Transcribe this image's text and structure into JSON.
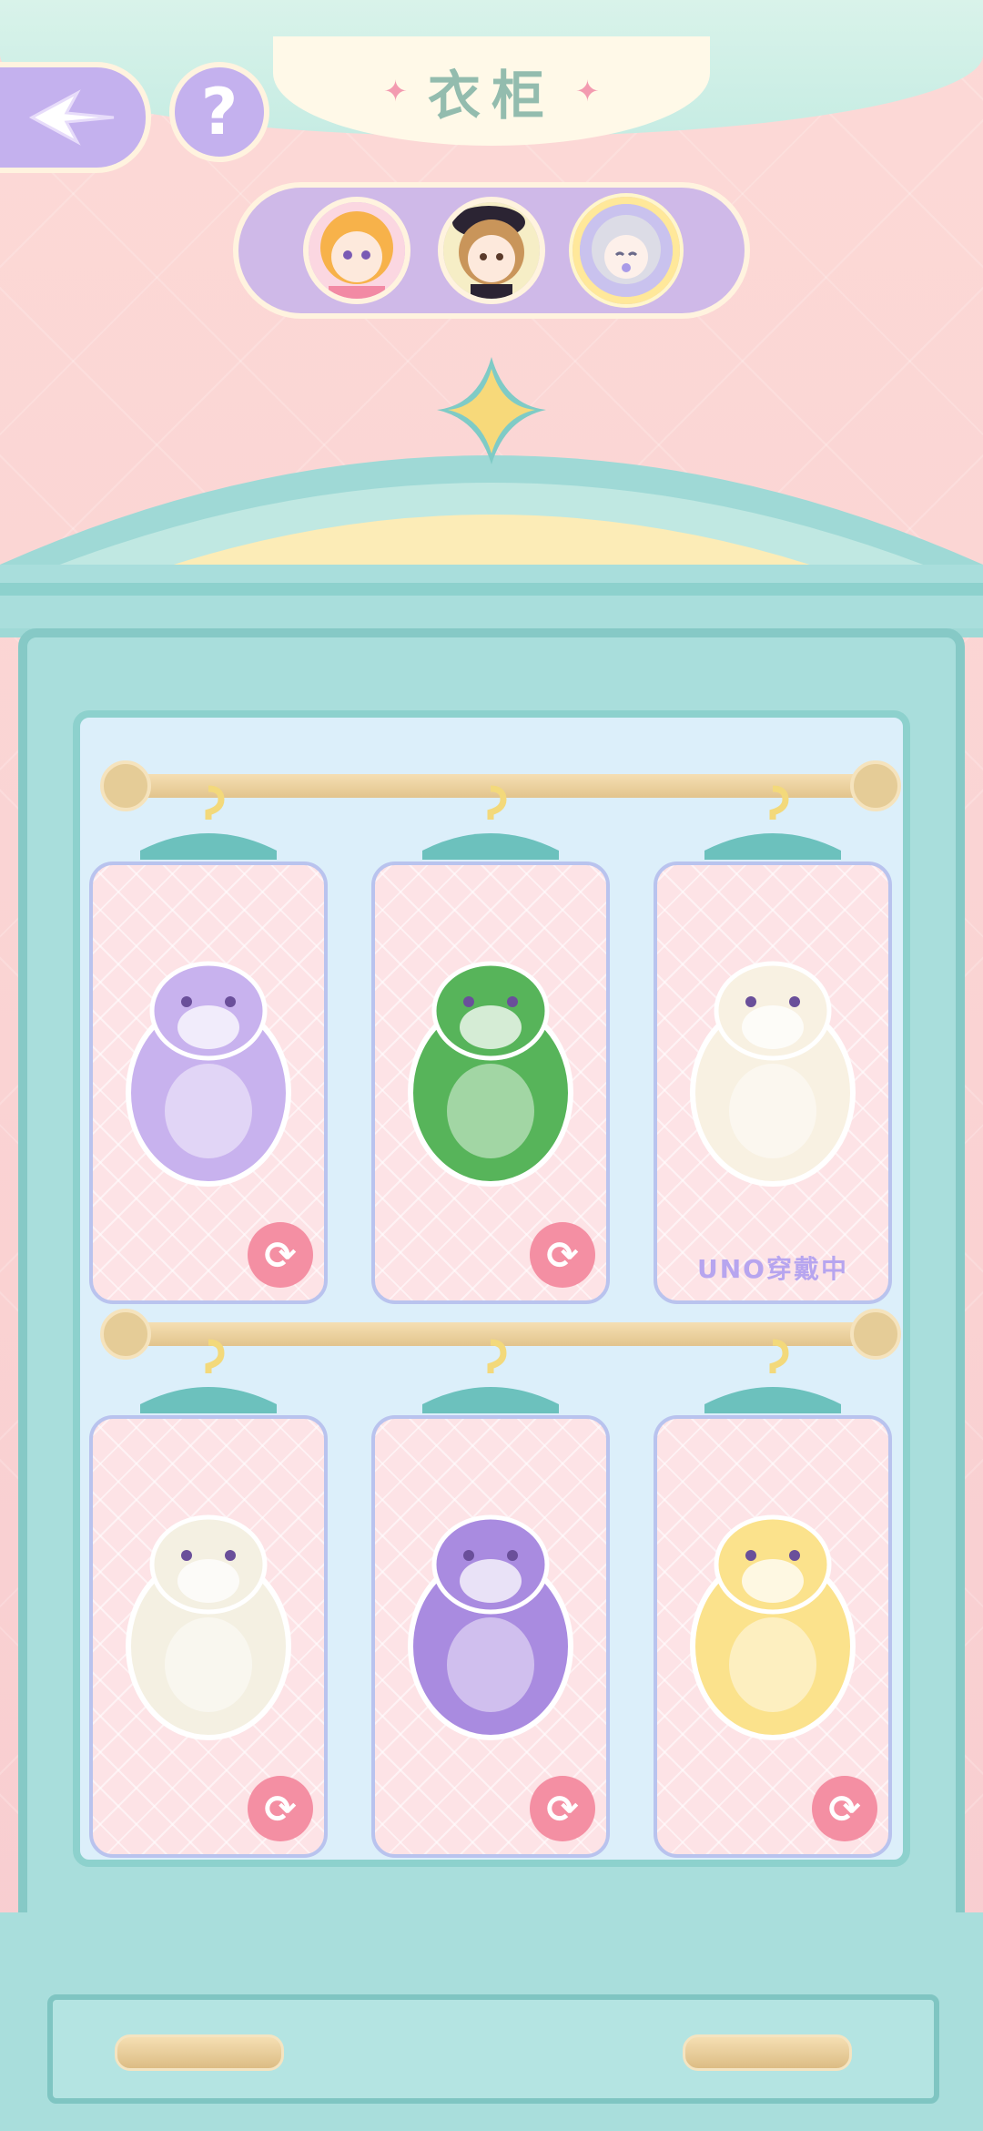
{
  "header": {
    "title": "衣柜",
    "back_icon": "back-arrow-icon",
    "help_label": "?"
  },
  "characters": [
    {
      "name": "character-avatar-1",
      "hair": "#f7b24a",
      "selected": false
    },
    {
      "name": "character-avatar-2",
      "hair": "#c9955a",
      "selected": false
    },
    {
      "name": "character-avatar-3",
      "hair": "#cfcfd9",
      "selected": true
    }
  ],
  "outfits": [
    {
      "name": "outfit-purple-bear",
      "icon": "purple-bear-costume-icon",
      "body": "#c8b2ee",
      "action": "swap",
      "wearing_label": ""
    },
    {
      "name": "outfit-christmas-tree-snowman",
      "icon": "christmas-tree-snowman-costume-icon",
      "body": "#57b45a",
      "action": "swap",
      "wearing_label": ""
    },
    {
      "name": "outfit-mummy",
      "icon": "mummy-costume-icon",
      "body": "#f8f1e2",
      "action": "wearing",
      "wearing_label": "UNO穿戴中"
    },
    {
      "name": "outfit-lion-dance",
      "icon": "lion-dance-costume-icon",
      "body": "#f4f0e2",
      "action": "swap",
      "wearing_label": ""
    },
    {
      "name": "outfit-purple-devil",
      "icon": "purple-devil-costume-icon",
      "body": "#a98be0",
      "action": "swap",
      "wearing_label": ""
    },
    {
      "name": "outfit-yellow-angel-chick",
      "icon": "yellow-angel-chick-costume-icon",
      "body": "#fbe28c",
      "action": "swap",
      "wearing_label": ""
    }
  ],
  "swap_icon_glyph": "⟳",
  "colors": {
    "accent_purple": "#c4b1ee",
    "wardrobe_teal": "#a9dedc",
    "card_pink": "#fde3e6",
    "swap_pink": "#f48fa3",
    "gold": "#f7d97a"
  }
}
